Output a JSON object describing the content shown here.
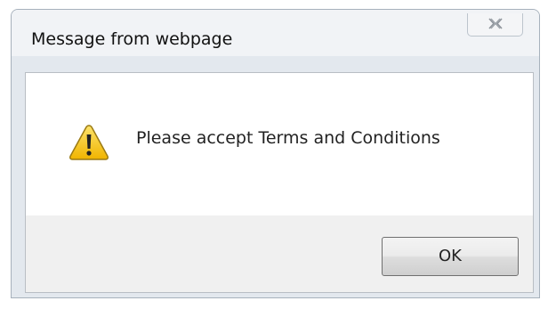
{
  "dialog": {
    "title": "Message from webpage",
    "close_icon": "close-x-icon",
    "message_icon": "warning-icon",
    "message": "Please accept Terms and Conditions",
    "ok_label": "OK"
  },
  "colors": {
    "warning_fill": "#f3c316",
    "warning_stroke": "#9b7a14",
    "exclamation": "#222222",
    "frame": "#e3e8ee",
    "footer": "#f0f0f0"
  }
}
